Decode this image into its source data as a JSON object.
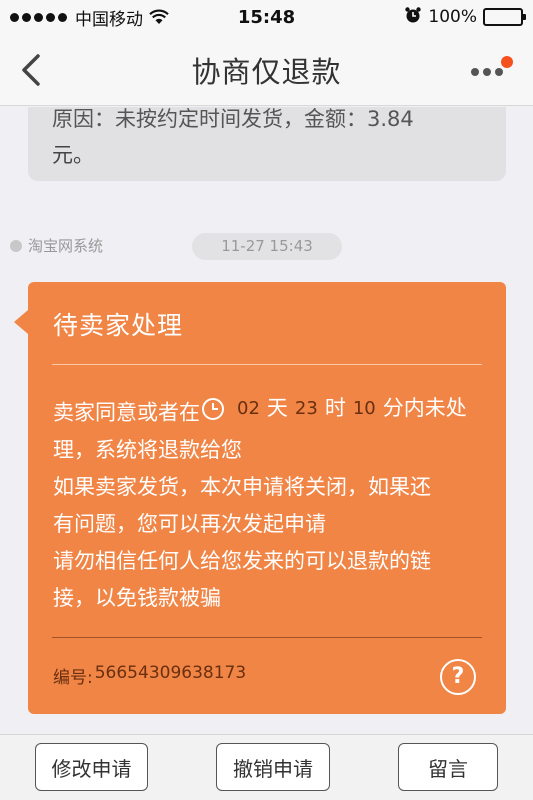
{
  "status_bar": {
    "carrier": "中国移动",
    "time": "15:48",
    "battery": "100%"
  },
  "nav": {
    "title": "协商仅退款"
  },
  "previous_message": {
    "text_clipped": "原因：未按约定时间发货，金额：3.84",
    "text_line2": "元。"
  },
  "message": {
    "sender": "淘宝网系统",
    "timestamp": "11-27 15:43",
    "title": "待卖家处理",
    "body": {
      "line1_prefix": "卖家同意或者在",
      "days": "02",
      "days_unit": "天",
      "hours": "23",
      "hours_unit": "时",
      "minutes": "10",
      "minutes_unit": "分内未处",
      "line2": "理，系统将退款给您",
      "line3": "如果卖家发货，本次申请将关闭，如果还",
      "line4": "有问题，您可以再次发起申请",
      "line5": "请勿相信任何人给您发来的可以退款的链",
      "line6": "接，以免钱款被骗"
    },
    "ref_label": "编号:",
    "ref_number": "56654309638173"
  },
  "toolbar": {
    "modify_label": "修改申请",
    "cancel_label": "撤销申请",
    "message_label": "留言"
  },
  "colors": {
    "card_bg": "#f08546",
    "badge": "#f5511e"
  }
}
